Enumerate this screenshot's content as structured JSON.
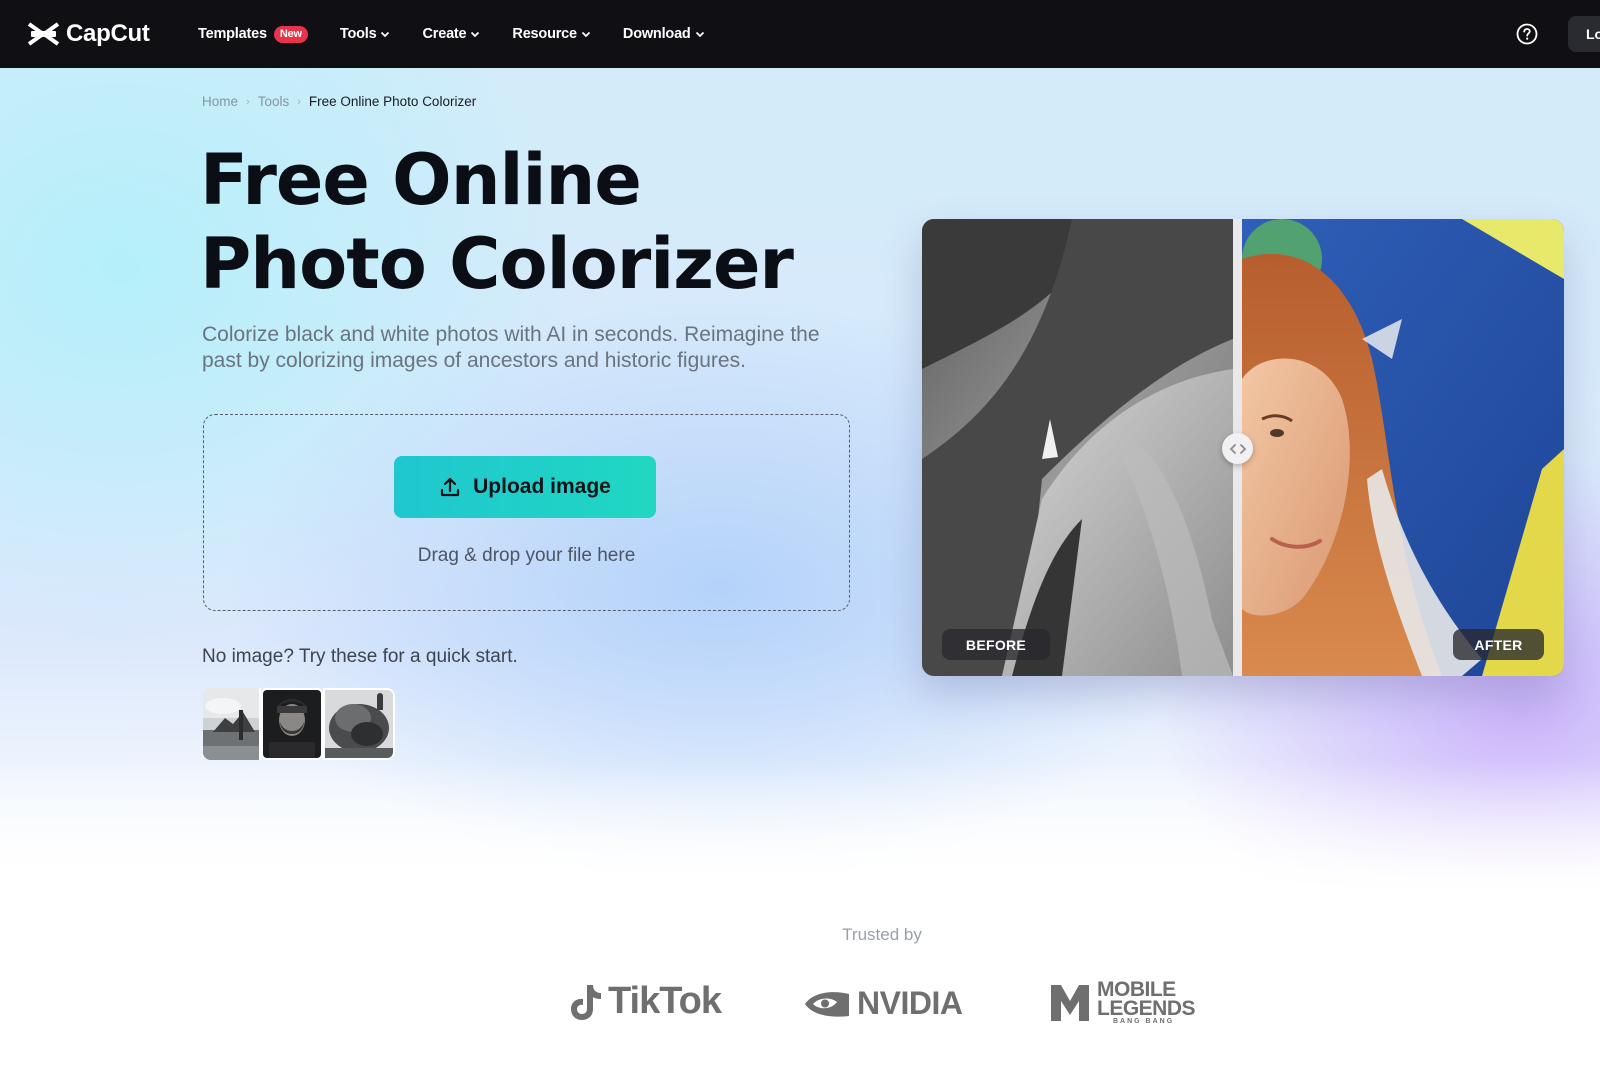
{
  "nav": {
    "logo_text": "CapCut",
    "items": [
      {
        "label": "Templates",
        "badge": "New",
        "has_dropdown": false
      },
      {
        "label": "Tools",
        "has_dropdown": true
      },
      {
        "label": "Create",
        "has_dropdown": true
      },
      {
        "label": "Resource",
        "has_dropdown": true
      },
      {
        "label": "Download",
        "has_dropdown": true
      }
    ],
    "help_icon": "question-circle-icon",
    "login_label": "Lo"
  },
  "breadcrumb": {
    "items": [
      "Home",
      "Tools",
      "Free Online Photo Colorizer"
    ],
    "separator": "›"
  },
  "hero": {
    "title": "Free Online Photo Colorizer",
    "subtitle": "Colorize black and white photos with AI in seconds. Reimagine the past by colorizing images of ancestors and historic figures.",
    "upload_label": "Upload image",
    "upload_icon": "upload-arrow-icon",
    "drag_text": "Drag & drop your file here",
    "quick_start_text": "No image? Try these for a quick start.",
    "sample_images": [
      "vintage-scene-bw",
      "bearded-man-bw",
      "historic-figures-bw"
    ]
  },
  "compare": {
    "before_label": "BEFORE",
    "after_label": "AFTER",
    "handle_icon": "left-right-arrows-icon"
  },
  "trusted": {
    "label": "Trusted by",
    "brands": [
      "TikTok",
      "NVIDIA",
      "MOBILE",
      "LEGENDS",
      "BANG BANG"
    ]
  },
  "colors": {
    "nav_bg": "#0f0f14",
    "accent_start": "#1fc7cf",
    "accent_end": "#21d7c2",
    "badge": "#e8344a",
    "title": "#0c0e16"
  }
}
